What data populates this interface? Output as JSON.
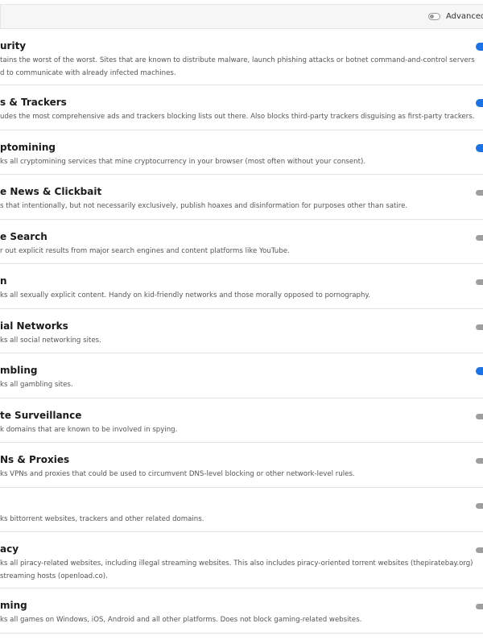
{
  "header": {
    "advanced_label": "Advanced M",
    "advanced_enabled": false
  },
  "colors": {
    "toggle_on": "#1a73e8",
    "toggle_off": "#9e9e9e"
  },
  "items": [
    {
      "title": "urity",
      "desc": [
        "tains the worst of the worst. Sites that are known to distribute malware, launch phishing attacks or botnet command-and-control servers",
        "d to communicate with already infected machines."
      ],
      "enabled": true
    },
    {
      "title": "s & Trackers",
      "desc": [
        "udes the most comprehensive ads and trackers blocking lists out there. Also blocks third-party trackers disguising as first-party trackers."
      ],
      "enabled": true
    },
    {
      "title": "ptomining",
      "desc": [
        "ks all cryptomining services that mine cryptocurrency in your browser (most often without your consent)."
      ],
      "enabled": true
    },
    {
      "title": "e News & Clickbait",
      "desc": [
        "s that intentionally, but not necessarily exclusively, publish hoaxes and disinformation for purposes other than satire."
      ],
      "enabled": false
    },
    {
      "title": "e Search",
      "desc": [
        "r out explicit results from major search engines and content platforms like YouTube."
      ],
      "enabled": false
    },
    {
      "title": "n",
      "desc": [
        "ks all sexually explicit content. Handy on kid-friendly networks and those morally opposed to pornography."
      ],
      "enabled": false
    },
    {
      "title": "ial Networks",
      "desc": [
        "ks all social networking sites."
      ],
      "enabled": false
    },
    {
      "title": "mbling",
      "desc": [
        "ks all gambling sites."
      ],
      "enabled": true
    },
    {
      "title": "te Surveillance",
      "desc": [
        "k domains that are known to be involved in spying."
      ],
      "enabled": false
    },
    {
      "title": "Ns & Proxies",
      "desc": [
        "ks VPNs and proxies that could be used to circumvent DNS-level blocking or other network-level rules."
      ],
      "enabled": false
    },
    {
      "title": "",
      "desc": [
        "ks bittorrent websites, trackers and other related domains."
      ],
      "enabled": false
    },
    {
      "title": "acy",
      "desc": [
        "ks all piracy-related websites, including illegal streaming websites. This also includes piracy-oriented torrent websites (thepiratebay.org)",
        "streaming hosts (openload.co)."
      ],
      "enabled": false
    },
    {
      "title": "ming",
      "desc": [
        "ks all games on Windows, iOS, Android and all other platforms. Does not block gaming-related websites."
      ],
      "enabled": false
    }
  ]
}
